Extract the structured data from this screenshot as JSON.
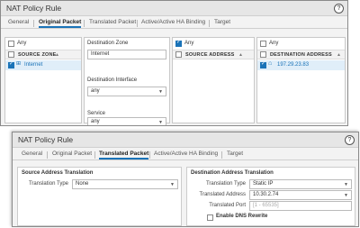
{
  "top_dialog": {
    "title": "NAT Policy Rule",
    "tabs": [
      "General",
      "Original Packet",
      "Translated Packet",
      "Active/Active HA Binding",
      "Target"
    ],
    "active_tab": "Original Packet",
    "source_zone": {
      "any_label": "Any",
      "header": "SOURCE ZONE",
      "rows": [
        "Internet"
      ]
    },
    "destination_zone": {
      "label": "Destination Zone",
      "value": "Internet"
    },
    "destination_interface": {
      "label": "Destination Interface",
      "value": "any"
    },
    "service": {
      "label": "Service",
      "value": "any"
    },
    "source_address": {
      "any_label": "Any",
      "header": "SOURCE ADDRESS"
    },
    "destination_address": {
      "any_label": "Any",
      "header": "DESTINATION ADDRESS",
      "rows": [
        "197.29.23.83"
      ]
    }
  },
  "bottom_dialog": {
    "title": "NAT Policy Rule",
    "tabs": [
      "General",
      "Original Packet",
      "Translated Packet",
      "Active/Active HA Binding",
      "Target"
    ],
    "active_tab": "Translated Packet",
    "sat": {
      "title": "Source Address Translation",
      "translation_type_label": "Translation Type",
      "translation_type_value": "None"
    },
    "dat": {
      "title": "Destination Address Translation",
      "translation_type_label": "Translation Type",
      "translation_type_value": "Static IP",
      "translated_address_label": "Translated Address",
      "translated_address_value": "10.30.2.74",
      "translated_port_label": "Translated Port",
      "translated_port_placeholder": "[1 - 65535]",
      "dns_rewrite_label": "Enable DNS Rewrite"
    }
  }
}
